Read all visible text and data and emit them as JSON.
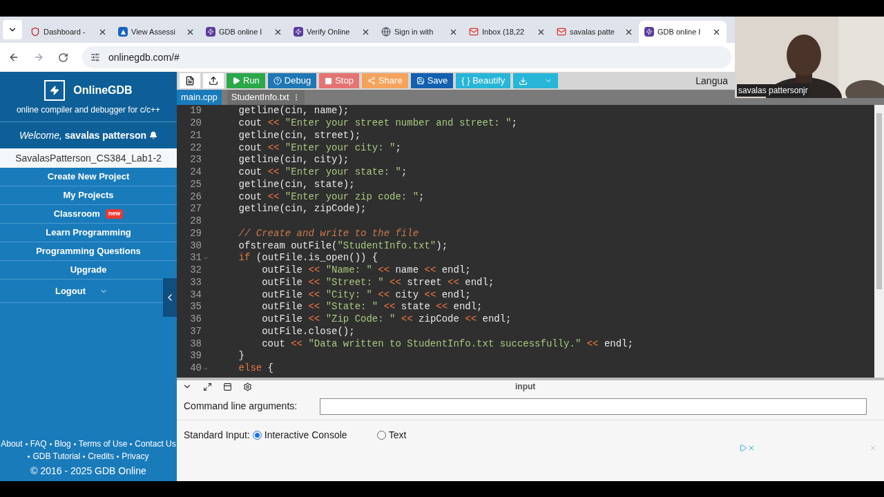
{
  "browser": {
    "tabs": [
      {
        "title": "Dashboard -",
        "selected": false
      },
      {
        "title": "View Assessi",
        "selected": false
      },
      {
        "title": "GDB online I",
        "selected": false
      },
      {
        "title": "Verify Online",
        "selected": false
      },
      {
        "title": "Sign in with",
        "selected": false
      },
      {
        "title": "Inbox (18,22",
        "selected": false
      },
      {
        "title": "savalas patte",
        "selected": false
      },
      {
        "title": "GDB online I",
        "selected": true
      }
    ],
    "url": "onlinegdb.com/#"
  },
  "sidebar": {
    "brand": "OnlineGDB",
    "tagline": "online compiler and debugger for c/c++",
    "welcome": "*Welcome,* **savalas patterson**",
    "project": "SavalasPatterson_CS384_Lab1-2",
    "items": [
      {
        "label": "Create New Project",
        "dropdown": false
      },
      {
        "label": "My Projects",
        "dropdown": false
      },
      {
        "label": "Classroom",
        "badge": "new",
        "dropdown": false
      },
      {
        "label": "Learn Programming",
        "dropdown": false
      },
      {
        "label": "Programming Questions",
        "dropdown": false
      },
      {
        "label": "Upgrade",
        "dropdown": false
      },
      {
        "label": "Logout",
        "dropdown": true
      }
    ],
    "footer_links": [
      [
        "About",
        "FAQ",
        "Blog",
        "Terms of Use",
        "Contact Us"
      ],
      [
        "GDB Tutorial",
        "Credits",
        "Privacy"
      ]
    ],
    "copyright": "© 2016 - 2025 GDB Online"
  },
  "toolbar": {
    "buttons": [
      {
        "kind": "new"
      },
      {
        "kind": "upload"
      },
      {
        "kind": "run",
        "label": "Run"
      },
      {
        "kind": "debug",
        "label": "Debug"
      },
      {
        "kind": "stop",
        "label": "Stop"
      },
      {
        "kind": "share",
        "label": "Share"
      },
      {
        "kind": "save",
        "label": "Save"
      },
      {
        "kind": "beautify",
        "label": "{ } Beautify"
      },
      {
        "kind": "download"
      }
    ],
    "language_label": "Langua"
  },
  "file_tabs": [
    {
      "label": "main.cpp",
      "selected": true,
      "menu": false
    },
    {
      "label": "StudentInfo.txt",
      "selected": false,
      "menu": true
    }
  ],
  "code": [
    {
      "n": "19",
      "fold": false,
      "seg": [
        {
          "kind": "plain",
          "text": "    getline(cin, name);"
        }
      ]
    },
    {
      "n": "20",
      "fold": false,
      "seg": [
        {
          "kind": "plain",
          "text": "    cout "
        },
        {
          "kind": "op",
          "text": "<<"
        },
        {
          "kind": "string",
          "text": " \"Enter your street number and street: \""
        },
        {
          "kind": "plain",
          "text": ";"
        }
      ]
    },
    {
      "n": "21",
      "fold": false,
      "seg": [
        {
          "kind": "plain",
          "text": "    getline(cin, street);"
        }
      ]
    },
    {
      "n": "22",
      "fold": false,
      "seg": [
        {
          "kind": "plain",
          "text": "    cout "
        },
        {
          "kind": "op",
          "text": "<<"
        },
        {
          "kind": "string",
          "text": " \"Enter your city: \""
        },
        {
          "kind": "plain",
          "text": ";"
        }
      ]
    },
    {
      "n": "23",
      "fold": false,
      "seg": [
        {
          "kind": "plain",
          "text": "    getline(cin, city);"
        }
      ]
    },
    {
      "n": "24",
      "fold": false,
      "seg": [
        {
          "kind": "plain",
          "text": "    cout "
        },
        {
          "kind": "op",
          "text": "<<"
        },
        {
          "kind": "string",
          "text": " \"Enter your state: \""
        },
        {
          "kind": "plain",
          "text": ";"
        }
      ]
    },
    {
      "n": "25",
      "fold": false,
      "seg": [
        {
          "kind": "plain",
          "text": "    getline(cin, state);"
        }
      ]
    },
    {
      "n": "26",
      "fold": false,
      "seg": [
        {
          "kind": "plain",
          "text": "    cout "
        },
        {
          "kind": "op",
          "text": "<<"
        },
        {
          "kind": "string",
          "text": " \"Enter your zip code: \""
        },
        {
          "kind": "plain",
          "text": ";"
        }
      ]
    },
    {
      "n": "27",
      "fold": false,
      "seg": [
        {
          "kind": "plain",
          "text": "    getline(cin, zipCode);"
        }
      ]
    },
    {
      "n": "28",
      "fold": false
    },
    {
      "n": "29",
      "fold": false,
      "seg": [
        {
          "kind": "comment",
          "text": "    // Create and write to the file"
        }
      ]
    },
    {
      "n": "30",
      "fold": false,
      "seg": [
        {
          "kind": "plain",
          "text": "    ofstream outFile("
        },
        {
          "kind": "string",
          "text": "\"StudentInfo.txt\""
        },
        {
          "kind": "plain",
          "text": ");"
        }
      ]
    },
    {
      "n": "31",
      "fold": true,
      "seg": [
        {
          "kind": "keyword",
          "text": "    if"
        },
        {
          "kind": "plain",
          "text": " (outFile.is_open()) {"
        }
      ]
    },
    {
      "n": "32",
      "fold": false,
      "seg": [
        {
          "kind": "plain",
          "text": "        outFile "
        },
        {
          "kind": "op",
          "text": "<<"
        },
        {
          "kind": "string",
          "text": " \"Name: \" "
        },
        {
          "kind": "op",
          "text": "<<"
        },
        {
          "kind": "plain",
          "text": " name "
        },
        {
          "kind": "op",
          "text": "<<"
        },
        {
          "kind": "plain",
          "text": " endl;"
        }
      ]
    },
    {
      "n": "33",
      "fold": false,
      "seg": [
        {
          "kind": "plain",
          "text": "        outFile "
        },
        {
          "kind": "op",
          "text": "<<"
        },
        {
          "kind": "string",
          "text": " \"Street: \" "
        },
        {
          "kind": "op",
          "text": "<<"
        },
        {
          "kind": "plain",
          "text": " street "
        },
        {
          "kind": "op",
          "text": "<<"
        },
        {
          "kind": "plain",
          "text": " endl;"
        }
      ]
    },
    {
      "n": "34",
      "fold": false,
      "seg": [
        {
          "kind": "plain",
          "text": "        outFile "
        },
        {
          "kind": "op",
          "text": "<<"
        },
        {
          "kind": "string",
          "text": " \"City: \" "
        },
        {
          "kind": "op",
          "text": "<<"
        },
        {
          "kind": "plain",
          "text": " city "
        },
        {
          "kind": "op",
          "text": "<<"
        },
        {
          "kind": "plain",
          "text": " endl;"
        }
      ]
    },
    {
      "n": "35",
      "fold": false,
      "seg": [
        {
          "kind": "plain",
          "text": "        outFile "
        },
        {
          "kind": "op",
          "text": "<<"
        },
        {
          "kind": "string",
          "text": " \"State: \" "
        },
        {
          "kind": "op",
          "text": "<<"
        },
        {
          "kind": "plain",
          "text": " state "
        },
        {
          "kind": "op",
          "text": "<<"
        },
        {
          "kind": "plain",
          "text": " endl;"
        }
      ]
    },
    {
      "n": "36",
      "fold": false,
      "seg": [
        {
          "kind": "plain",
          "text": "        outFile "
        },
        {
          "kind": "op",
          "text": "<<"
        },
        {
          "kind": "string",
          "text": " \"Zip Code: \" "
        },
        {
          "kind": "op",
          "text": "<<"
        },
        {
          "kind": "plain",
          "text": " zipCode "
        },
        {
          "kind": "op",
          "text": "<<"
        },
        {
          "kind": "plain",
          "text": " endl;"
        }
      ]
    },
    {
      "n": "37",
      "fold": false,
      "seg": [
        {
          "kind": "plain",
          "text": "        outFile.close();"
        }
      ]
    },
    {
      "n": "38",
      "fold": false,
      "seg": [
        {
          "kind": "plain",
          "text": "        cout "
        },
        {
          "kind": "op",
          "text": "<<"
        },
        {
          "kind": "string",
          "text": " \"Data written to StudentInfo.txt successfully.\" "
        },
        {
          "kind": "op",
          "text": "<<"
        },
        {
          "kind": "plain",
          "text": " endl;"
        }
      ]
    },
    {
      "n": "39",
      "fold": false,
      "seg": [
        {
          "kind": "plain",
          "text": "    }"
        }
      ]
    },
    {
      "n": "40",
      "fold": true,
      "seg": [
        {
          "kind": "keyword",
          "text": "    else"
        },
        {
          "kind": "plain",
          "text": " {"
        }
      ]
    }
  ],
  "input_panel": {
    "title": "input",
    "args_label": "Command line arguments:",
    "stdin_label": "Standard Input:",
    "options": [
      {
        "label": "Interactive Console",
        "selected": true
      },
      {
        "label": "Text",
        "selected": false
      }
    ]
  },
  "webcam": {
    "name": "savalas pattersonjr"
  }
}
